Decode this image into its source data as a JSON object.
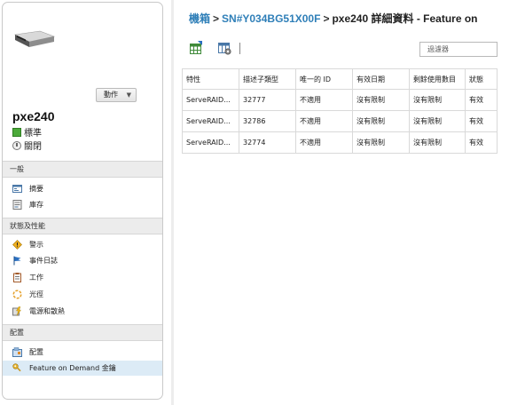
{
  "breadcrumb": {
    "root": "機箱",
    "serial": "SN#Y034BG51X00F",
    "current": "pxe240 詳細資料 - Feature on"
  },
  "device": {
    "name": "pxe240",
    "actions_label": "動作",
    "status_label": "標準",
    "power_label": "關閉"
  },
  "sections": {
    "general": {
      "title": "一般",
      "items": [
        {
          "label": "摘要",
          "icon": "summary-icon"
        },
        {
          "label": "庫存",
          "icon": "inventory-icon"
        }
      ]
    },
    "status": {
      "title": "狀態及性能",
      "items": [
        {
          "label": "警示",
          "icon": "alert-icon"
        },
        {
          "label": "事件日誌",
          "icon": "flag-icon"
        },
        {
          "label": "工作",
          "icon": "jobs-icon"
        },
        {
          "label": "光徑",
          "icon": "light-path-icon"
        },
        {
          "label": "電源和散熱",
          "icon": "power-cooling-icon"
        }
      ]
    },
    "config": {
      "title": "配置",
      "items": [
        {
          "label": "配置",
          "icon": "config-icon"
        },
        {
          "label": "Feature on Demand 金鑰",
          "icon": "key-icon"
        }
      ]
    }
  },
  "toolbar": {
    "filter_placeholder": "過濾器"
  },
  "table": {
    "columns": [
      "特性",
      "描述子類型",
      "唯一的 ID",
      "有效日期",
      "剩餘使用數目",
      "狀態"
    ],
    "rows": [
      [
        "ServeRAID...",
        "32777",
        "不適用",
        "沒有限制",
        "沒有限制",
        "有效"
      ],
      [
        "ServeRAID...",
        "32786",
        "不適用",
        "沒有限制",
        "沒有限制",
        "有效"
      ],
      [
        "ServeRAID...",
        "32774",
        "不適用",
        "沒有限制",
        "沒有限制",
        "有效"
      ]
    ]
  },
  "colors": {
    "link": "#2f7fb8",
    "status_green": "#4caa3a",
    "active_bg": "#dcebf6"
  }
}
